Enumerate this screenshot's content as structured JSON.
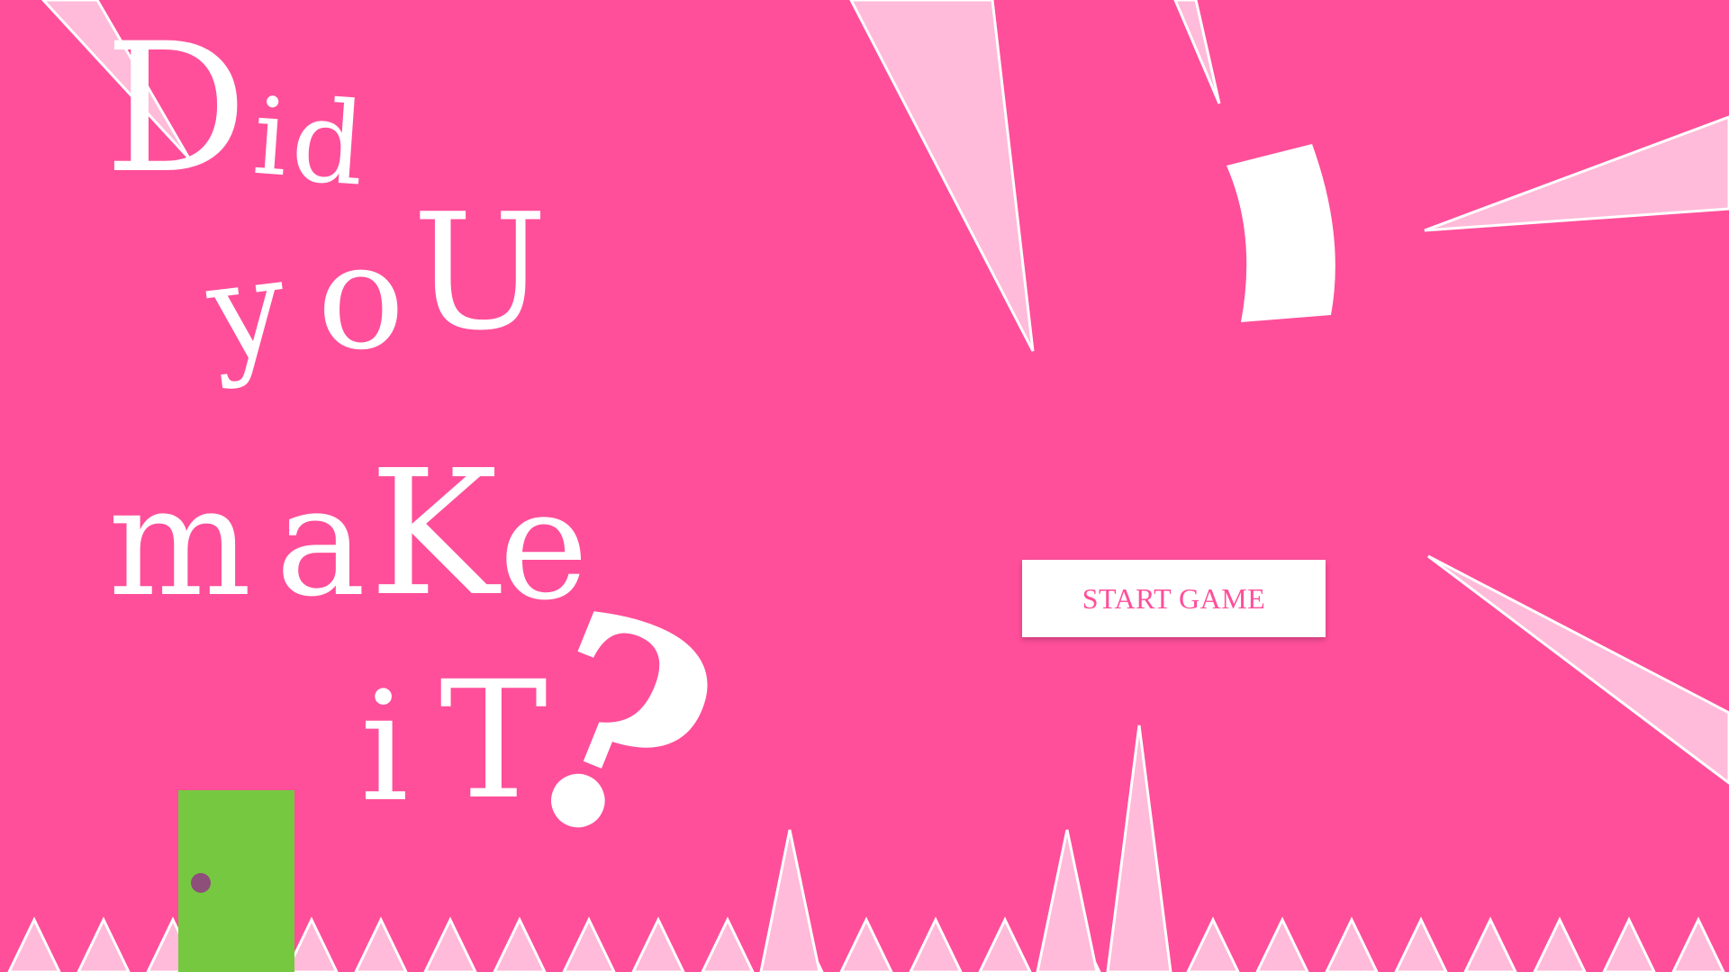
{
  "title": {
    "letters": [
      "D",
      "i",
      "d",
      "y",
      "o",
      "U",
      "m",
      "a",
      "K",
      "e",
      "i",
      "T"
    ],
    "question_mark": "?"
  },
  "start_button": {
    "label": "START GAME"
  },
  "colors": {
    "background": "#ff4f9a",
    "shard_fill": "#ffbbd9",
    "shard_stroke": "#ffffff",
    "text": "#ffffff",
    "door": "#77c841",
    "door_knob": "#8e4f7a",
    "button_text": "#ff4f9a"
  }
}
